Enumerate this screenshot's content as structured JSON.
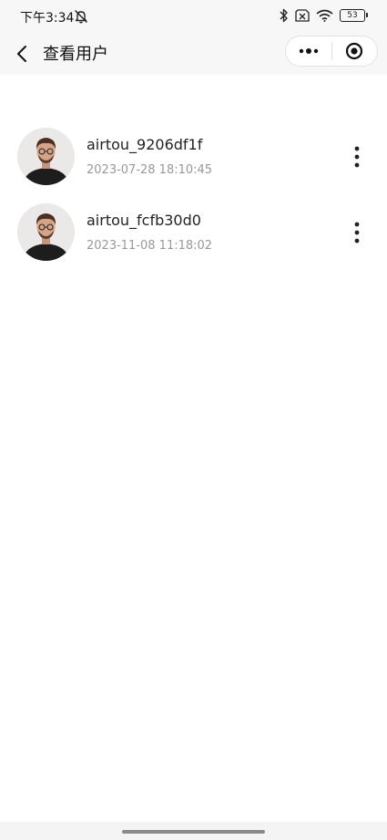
{
  "status_bar": {
    "time": "下午3:34",
    "battery": "53",
    "icons": [
      "muted-notification-icon",
      "bluetooth-icon",
      "no-sim-icon",
      "wifi-icon",
      "battery-icon"
    ]
  },
  "header": {
    "title": "查看用户",
    "icons": [
      "back-icon",
      "more-dots-icon",
      "close-target-icon"
    ]
  },
  "users": [
    {
      "name": "airtou_9206df1f",
      "date": "2023-07-28 18:10:45"
    },
    {
      "name": "airtou_fcfb30d0",
      "date": "2023-11-08 11:18:02"
    }
  ],
  "colors": {
    "background": "#ffffff",
    "bar": "#f7f7f7",
    "name_text": "#222222",
    "date_text": "#999999"
  }
}
